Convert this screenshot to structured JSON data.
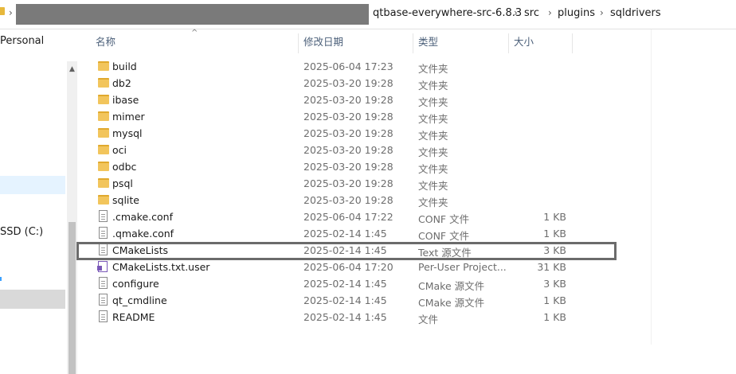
{
  "addressbar": {
    "crumbs": [
      "qtbase-everywhere-src-6.8.3",
      "src",
      "plugins",
      "sqldrivers"
    ]
  },
  "sidebar": {
    "items": [
      {
        "label": "Personal"
      },
      {
        "label": "SSD (C:)"
      }
    ]
  },
  "columns": {
    "name": "名称",
    "date": "修改日期",
    "type": "类型",
    "size": "大小"
  },
  "files": [
    {
      "name": "build",
      "date": "2025-06-04 17:23",
      "type": "文件夹",
      "size": "",
      "icon": "folder-icon"
    },
    {
      "name": "db2",
      "date": "2025-03-20 19:28",
      "type": "文件夹",
      "size": "",
      "icon": "folder-icon"
    },
    {
      "name": "ibase",
      "date": "2025-03-20 19:28",
      "type": "文件夹",
      "size": "",
      "icon": "folder-icon"
    },
    {
      "name": "mimer",
      "date": "2025-03-20 19:28",
      "type": "文件夹",
      "size": "",
      "icon": "folder-icon"
    },
    {
      "name": "mysql",
      "date": "2025-03-20 19:28",
      "type": "文件夹",
      "size": "",
      "icon": "folder-icon"
    },
    {
      "name": "oci",
      "date": "2025-03-20 19:28",
      "type": "文件夹",
      "size": "",
      "icon": "folder-icon"
    },
    {
      "name": "odbc",
      "date": "2025-03-20 19:28",
      "type": "文件夹",
      "size": "",
      "icon": "folder-icon"
    },
    {
      "name": "psql",
      "date": "2025-03-20 19:28",
      "type": "文件夹",
      "size": "",
      "icon": "folder-icon"
    },
    {
      "name": "sqlite",
      "date": "2025-03-20 19:28",
      "type": "文件夹",
      "size": "",
      "icon": "folder-icon"
    },
    {
      "name": ".cmake.conf",
      "date": "2025-06-04 17:22",
      "type": "CONF 文件",
      "size": "1 KB",
      "icon": "file-icon"
    },
    {
      "name": ".qmake.conf",
      "date": "2025-02-14 1:45",
      "type": "CONF 文件",
      "size": "1 KB",
      "icon": "file-icon"
    },
    {
      "name": "CMakeLists",
      "date": "2025-02-14 1:45",
      "type": "Text 源文件",
      "size": "3 KB",
      "icon": "text-file-icon"
    },
    {
      "name": "CMakeLists.txt.user",
      "date": "2025-06-04 17:20",
      "type": "Per-User Project...",
      "size": "31 KB",
      "icon": "visual-studio-file-icon"
    },
    {
      "name": "configure",
      "date": "2025-02-14 1:45",
      "type": "CMake 源文件",
      "size": "3 KB",
      "icon": "file-icon"
    },
    {
      "name": "qt_cmdline",
      "date": "2025-02-14 1:45",
      "type": "CMake 源文件",
      "size": "1 KB",
      "icon": "file-icon"
    },
    {
      "name": "README",
      "date": "2025-02-14 1:45",
      "type": "文件",
      "size": "1 KB",
      "icon": "file-icon"
    }
  ],
  "colors": {
    "folder": "#f2c55c",
    "header_text": "#4c607a",
    "highlight_border": "#6b6b6b"
  }
}
